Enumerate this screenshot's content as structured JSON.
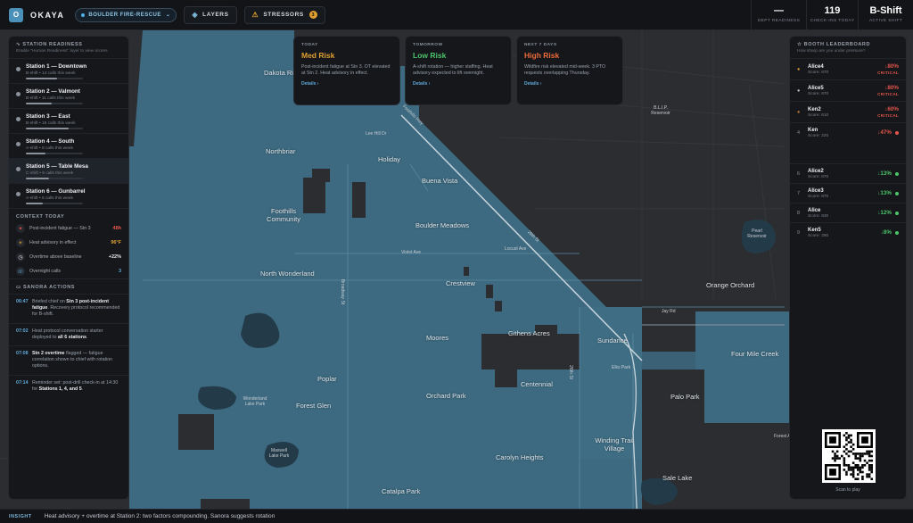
{
  "app": {
    "logo_letter": "O",
    "name": "OKAYA"
  },
  "org_select": {
    "label": "BOULDER FIRE-RESCUE"
  },
  "toolbar": {
    "layers_label": "LAYERS",
    "stressors_label": "STRESSORS",
    "stressors_count": "3"
  },
  "stats": [
    {
      "value": "—",
      "label": "DEPT READINESS"
    },
    {
      "value": "119",
      "label": "CHECK-INS TODAY"
    },
    {
      "value": "B-Shift",
      "label": "ACTIVE SHIFT"
    }
  ],
  "left": {
    "title": "STATION READINESS",
    "subtitle": "Enable \"Human Readiness\" layer to view scores",
    "stations": [
      {
        "name": "Station 1 — Downtown",
        "sub": "B-shift • 14 calls this week",
        "fill": 0.55
      },
      {
        "name": "Station 2 — Valmont",
        "sub": "B-shift • 11 calls this week",
        "fill": 0.45
      },
      {
        "name": "Station 3 — East",
        "sub": "B-shift • 19 calls this week",
        "fill": 0.75
      },
      {
        "name": "Station 4 — South",
        "sub": "A-shift • 8 calls this week",
        "fill": 0.35
      },
      {
        "name": "Station 5 — Table Mesa",
        "sub": "C-shift • 9 calls this week",
        "fill": 0.4
      },
      {
        "name": "Station 6 — Gunbarrel",
        "sub": "A-shift • 6 calls this week",
        "fill": 0.3
      }
    ],
    "context_title": "CONTEXT TODAY",
    "context": [
      {
        "icon": "✦",
        "label": "Post-incident fatigue — Stn 3",
        "value": "48h",
        "color": "#e5554b"
      },
      {
        "icon": "☀",
        "label": "Heat advisory in effect",
        "value": "96°F",
        "color": "#e0a030"
      },
      {
        "icon": "◷",
        "label": "Overtime above baseline",
        "value": "+22%",
        "color": "#e8eaee"
      },
      {
        "icon": "☏",
        "label": "Overnight calls",
        "value": "3",
        "color": "#5fa8d8"
      }
    ],
    "actions_title": "SANORA ACTIONS",
    "actions": [
      {
        "time": "06:47",
        "pre": "Briefed chief on ",
        "bold": "Stn 3 post-incident fatigue",
        "post": ". Recovery protocol recommended for B-shift."
      },
      {
        "time": "07:02",
        "pre": "Heat protocol conversation starter deployed to ",
        "bold": "all 6 stations",
        "post": "."
      },
      {
        "time": "07:08",
        "pre": "",
        "bold": "Stn 2 overtime",
        "post": " flagged — fatigue correlation shown to chief with rotation options."
      },
      {
        "time": "07:14",
        "pre": "Reminder set: post-drill check-in at 14:30 for ",
        "bold": "Stations 1, 4, and 5",
        "post": "."
      }
    ]
  },
  "forecast": [
    {
      "when": "TODAY",
      "risk": "Med Risk",
      "color": "#e0a030",
      "desc": "Post-incident fatigue at Stn 3. OT elevated at Stn 2. Heat advisory in effect.",
      "link": "Details ›"
    },
    {
      "when": "TOMORROW",
      "risk": "Low Risk",
      "color": "#4cc46a",
      "desc": "A-shift rotation — higher staffing. Heat advisory expected to lift overnight.",
      "link": "Details ›"
    },
    {
      "when": "NEXT 7 DAYS",
      "risk": "High Risk",
      "color": "#ee6a3a",
      "desc": "Wildfire risk elevated mid-week. 3 PTO requests overlapping Thursday.",
      "link": "Details ›"
    }
  ],
  "leaderboard": {
    "title": "BOOTH LEADERBOARD",
    "subtitle": "How sharp are you under pressure?",
    "rows": [
      {
        "rank": "●",
        "name": "Alice4",
        "score": "Score: 870",
        "pct": "↓80%",
        "tag": "CRITICAL",
        "color": "#e5554b",
        "medal": "#e0a030"
      },
      {
        "rank": "●",
        "name": "Alice5",
        "score": "Score: 870",
        "pct": "↓80%",
        "tag": "CRITICAL",
        "color": "#e5554b",
        "medal": "#c0c4ca"
      },
      {
        "rank": "●",
        "name": "Ken2",
        "score": "Score: 610",
        "pct": "↓60%",
        "tag": "CRITICAL",
        "color": "#e5554b",
        "medal": "#c07a3a"
      },
      {
        "rank": "4",
        "name": "Ken",
        "score": "Score: 220",
        "pct": "↓47%",
        "tag": "",
        "color": "#e5554b",
        "medal": ""
      },
      {
        "rank": "6",
        "name": "Alice2",
        "score": "Score: 870",
        "pct": "↓13%",
        "tag": "",
        "color": "#4cc46a",
        "medal": ""
      },
      {
        "rank": "7",
        "name": "Alice3",
        "score": "Score: 870",
        "pct": "↓13%",
        "tag": "",
        "color": "#4cc46a",
        "medal": ""
      },
      {
        "rank": "8",
        "name": "Alice",
        "score": "Score: 830",
        "pct": "↓12%",
        "tag": "",
        "color": "#4cc46a",
        "medal": ""
      },
      {
        "rank": "9",
        "name": "Ken5",
        "score": "Score: 280",
        "pct": "↓8%",
        "tag": "",
        "color": "#4cc46a",
        "medal": ""
      }
    ],
    "scan_label": "Scan to play"
  },
  "map": {
    "areas": [
      "Dakota Ridge",
      "Northbriar",
      "Holiday",
      "Buena Vista",
      "Foothills Community",
      "Boulder Meadows",
      "North Wonderland",
      "Crestview",
      "Orange Orchard",
      "Moores",
      "Githens Acres",
      "Sundance",
      "Four Mile Creek",
      "Poplar",
      "Centennial",
      "Palo Park",
      "Forest Glen",
      "Orchard Park",
      "Winding Trail Village",
      "Carolyn Heights",
      "Sale Lake",
      "Catalpa Park",
      "Pearl Reservoir",
      "B.L.I.P. Reservoir"
    ],
    "roads": [
      "Foothills Hwy",
      "Lee Hill Dr",
      "28th St",
      "Violet Ave",
      "Broadway St",
      "Jay Rd",
      "Wonderland Lake Park",
      "Elks Park",
      "26th St",
      "Locust Ave",
      "Forest Ave",
      "Maxwell Lake Park"
    ]
  },
  "insight": {
    "tag": "INSIGHT",
    "text": "Heat advisory + overtime at Station 2: two factors compounding. Sanora suggests rotation"
  }
}
